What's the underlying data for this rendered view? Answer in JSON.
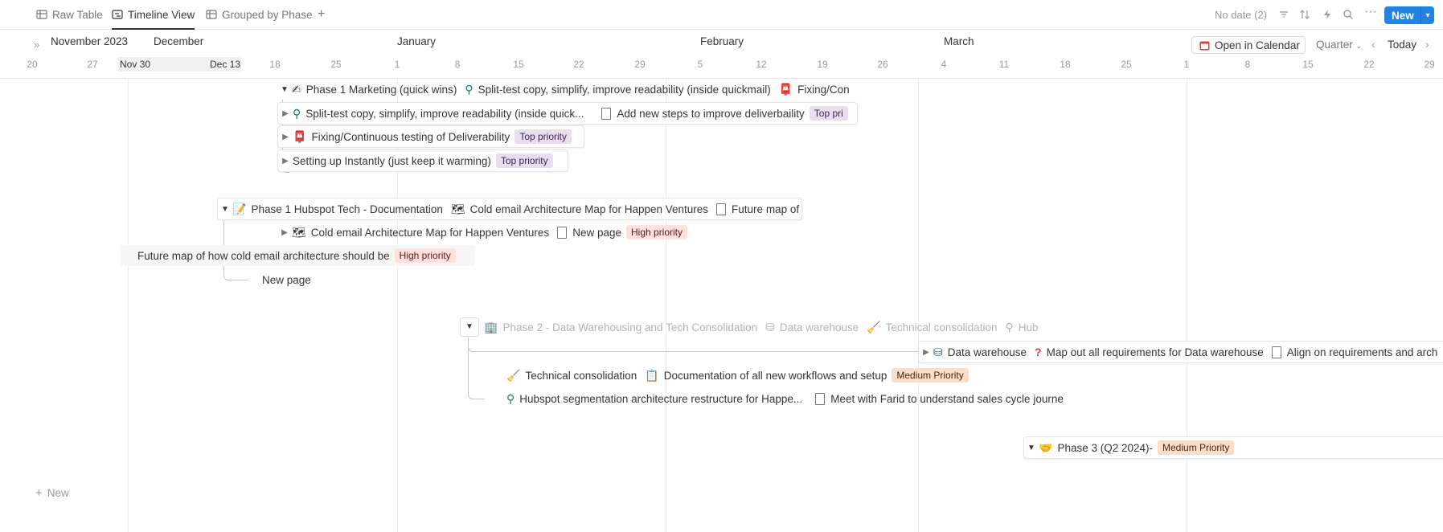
{
  "tabs": [
    {
      "label": "Raw Table",
      "icon": "table-icon",
      "active": false
    },
    {
      "label": "Timeline View",
      "icon": "timeline-icon",
      "active": true
    },
    {
      "label": "Grouped by Phase",
      "icon": "table-icon",
      "active": false
    }
  ],
  "toolbar": {
    "no_date": "No date (2)",
    "new_label": "New"
  },
  "timeline": {
    "current_month": "November 2023",
    "months": [
      "December",
      "January",
      "February",
      "March"
    ],
    "days": [
      "20",
      "27",
      "Nov 30",
      "Dec 13",
      "18",
      "25",
      "1",
      "8",
      "15",
      "22",
      "29",
      "5",
      "12",
      "19",
      "26",
      "4",
      "11",
      "18",
      "25",
      "1",
      "8",
      "15",
      "22",
      "29"
    ],
    "open_calendar": "Open in Calendar",
    "scale": "Quarter",
    "today": "Today"
  },
  "rows": {
    "r1": {
      "title": "Phase 1 Marketing (quick wins)",
      "sub1": "Split-test copy, simplify, improve readability (inside quickmail)",
      "sub2": "Fixing/Con"
    },
    "r2": {
      "title": "Split-test copy, simplify, improve readability (inside quick...",
      "sub1": "Add new steps to improve deliverbaility",
      "badge": "Top pri"
    },
    "r3": {
      "title": "Fixing/Continuous testing of Deliverability",
      "badge": "Top priority"
    },
    "r4": {
      "title": "Setting up Instantly (just keep it warming)",
      "badge": "Top priority"
    },
    "r5": {
      "title": "Phase 1 Hubspot Tech - Documentation",
      "sub1": "Cold email Architecture Map for Happen Ventures",
      "sub2": "Future map of"
    },
    "r6": {
      "title": "Cold email Architecture Map for Happen Ventures",
      "sub1": "New page",
      "badge": "High priority"
    },
    "r7": {
      "title": "Future map of how cold email architecture should be",
      "badge": "High priority"
    },
    "r8": {
      "title": "New page"
    },
    "r9": {
      "title": "Phase 2 - Data Warehousing and Tech Consolidation",
      "sub1": "Data warehouse",
      "sub2": "Technical consolidation",
      "sub3": "Hubspo"
    },
    "r10": {
      "title": "Data warehouse",
      "sub1": "Map out all requirements for Data warehouse",
      "sub2": "Align on requirements and arch"
    },
    "r11": {
      "title": "Technical consolidation",
      "sub1": "Documentation of all new workflows and setup",
      "badge": "Medium Priority"
    },
    "r12": {
      "title": "Hubspot segmentation architecture restructure for Happe...",
      "sub1": "Meet with Farid to understand sales cycle journe"
    },
    "r13": {
      "title": "Phase 3 (Q2 2024)-",
      "badge": "Medium Priority"
    }
  },
  "new_row_label": "New"
}
